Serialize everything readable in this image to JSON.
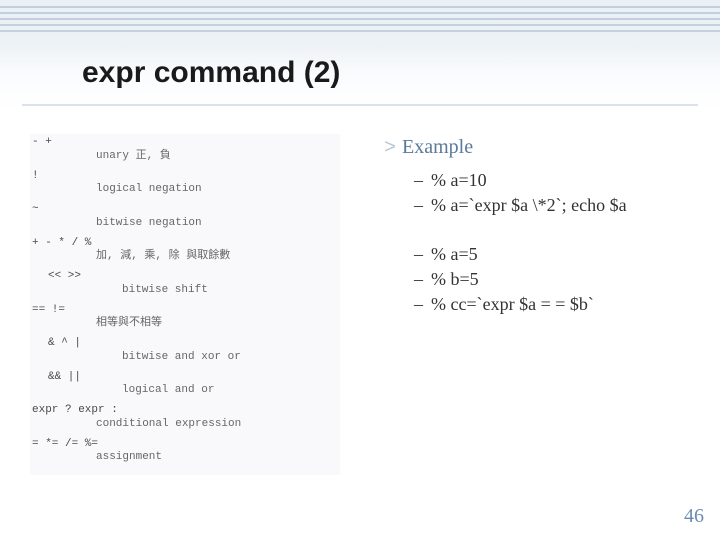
{
  "title": "expr command (2)",
  "operators": [
    {
      "sym": "- +",
      "desc": "unary 正, 負"
    },
    {
      "sym": "!",
      "desc": "logical negation"
    },
    {
      "sym": "~",
      "desc": "bitwise negation"
    },
    {
      "sym": "+ - * / %",
      "desc": "加, 減, 乘, 除 與取餘數"
    },
    {
      "sym": "<< >>",
      "desc": "bitwise shift"
    },
    {
      "sym": "== !=",
      "desc": "相等與不相等"
    },
    {
      "sym": "& ^ |",
      "desc": "bitwise and xor or"
    },
    {
      "sym": "&& ||",
      "desc": "logical and or"
    },
    {
      "sym": "expr ? expr :",
      "desc": "conditional expression"
    },
    {
      "sym": "= *= /= %=",
      "desc": "assignment"
    }
  ],
  "example": {
    "heading": "Example",
    "group1": [
      "% a=10",
      "% a=`expr $a \\*2`; echo $a"
    ],
    "group2": [
      "% a=5",
      "% b=5",
      "% cc=`expr $a = = $b`"
    ]
  },
  "page": "46"
}
